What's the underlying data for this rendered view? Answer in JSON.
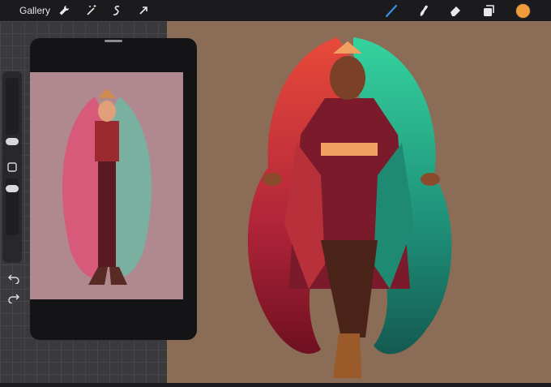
{
  "toolbar": {
    "gallery_label": "Gallery",
    "icons": [
      "wrench-icon",
      "magic-wand-icon",
      "selection-icon",
      "transform-arrow-icon",
      "brush-icon",
      "smudge-icon",
      "eraser-icon",
      "layers-icon",
      "color-icon"
    ],
    "active_tool": "brush-icon",
    "active_color": "#f39a3d"
  },
  "colors": {
    "canvas_bg": "#8b6c56",
    "accent_blue": "#3d8fe8"
  }
}
